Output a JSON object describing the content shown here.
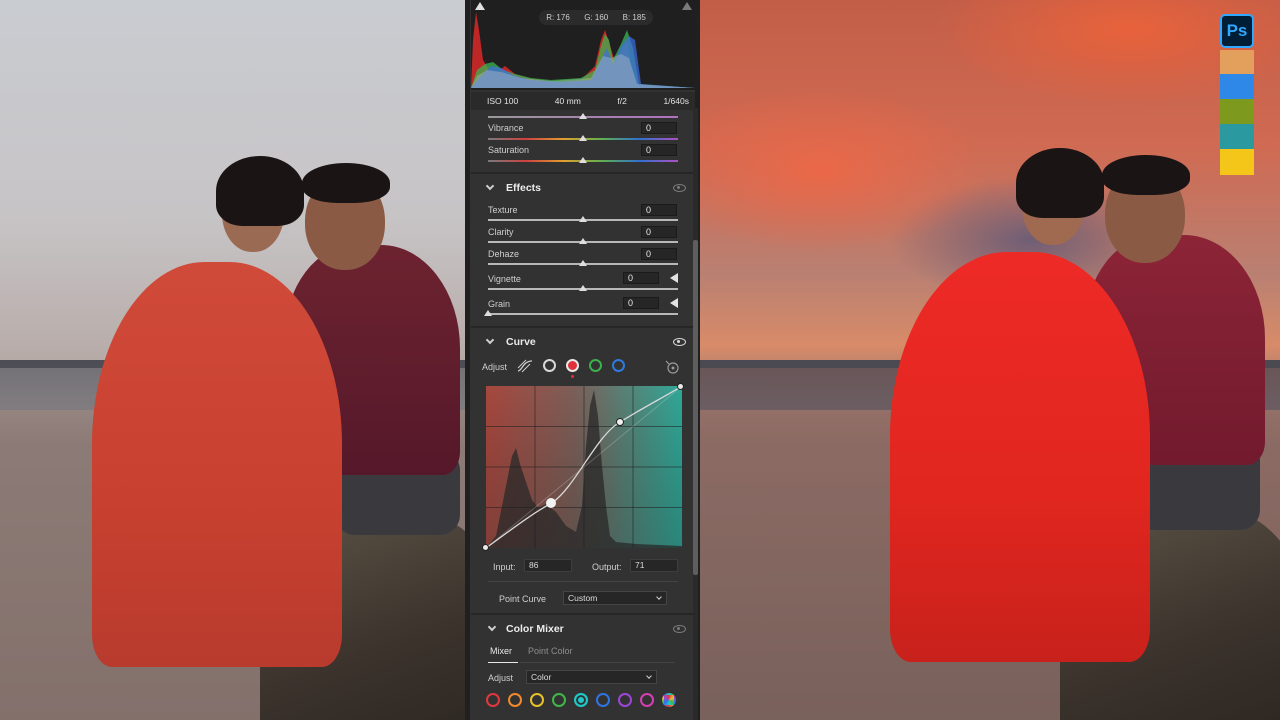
{
  "histogram": {
    "readout_r": "R: 176",
    "readout_g": "G: 160",
    "readout_b": "B: 185"
  },
  "camera_info": {
    "iso": "ISO 100",
    "focal": "40 mm",
    "aperture": "f/2",
    "shutter": "1/640s"
  },
  "presence": {
    "vibrance_label": "Vibrance",
    "vibrance_value": "0",
    "saturation_label": "Saturation",
    "saturation_value": "0"
  },
  "effects": {
    "title": "Effects",
    "texture_label": "Texture",
    "texture_value": "0",
    "clarity_label": "Clarity",
    "clarity_value": "0",
    "dehaze_label": "Dehaze",
    "dehaze_value": "0",
    "vignette_label": "Vignette",
    "vignette_value": "0",
    "grain_label": "Grain",
    "grain_value": "0"
  },
  "curve": {
    "title": "Curve",
    "adjust_label": "Adjust",
    "selected_channel": "red",
    "input_label": "Input:",
    "input_value": "86",
    "output_label": "Output:",
    "output_value": "71",
    "point_curve_label": "Point Curve",
    "point_curve_value": "Custom"
  },
  "color_mixer": {
    "title": "Color Mixer",
    "tab_mixer": "Mixer",
    "tab_point_color": "Point Color",
    "adjust_label": "Adjust",
    "adjust_value": "Color",
    "swatch_colors": [
      "#e0383d",
      "#f08a2c",
      "#e8c12a",
      "#43b649",
      "#1fc9c9",
      "#2f74e0",
      "#9d46d6",
      "#d63fb4"
    ]
  },
  "app": {
    "logo": "Ps"
  },
  "palette": [
    "#e2a05c",
    "#2e88e8",
    "#7d9a1e",
    "#2a9aa0",
    "#f5c61a"
  ]
}
